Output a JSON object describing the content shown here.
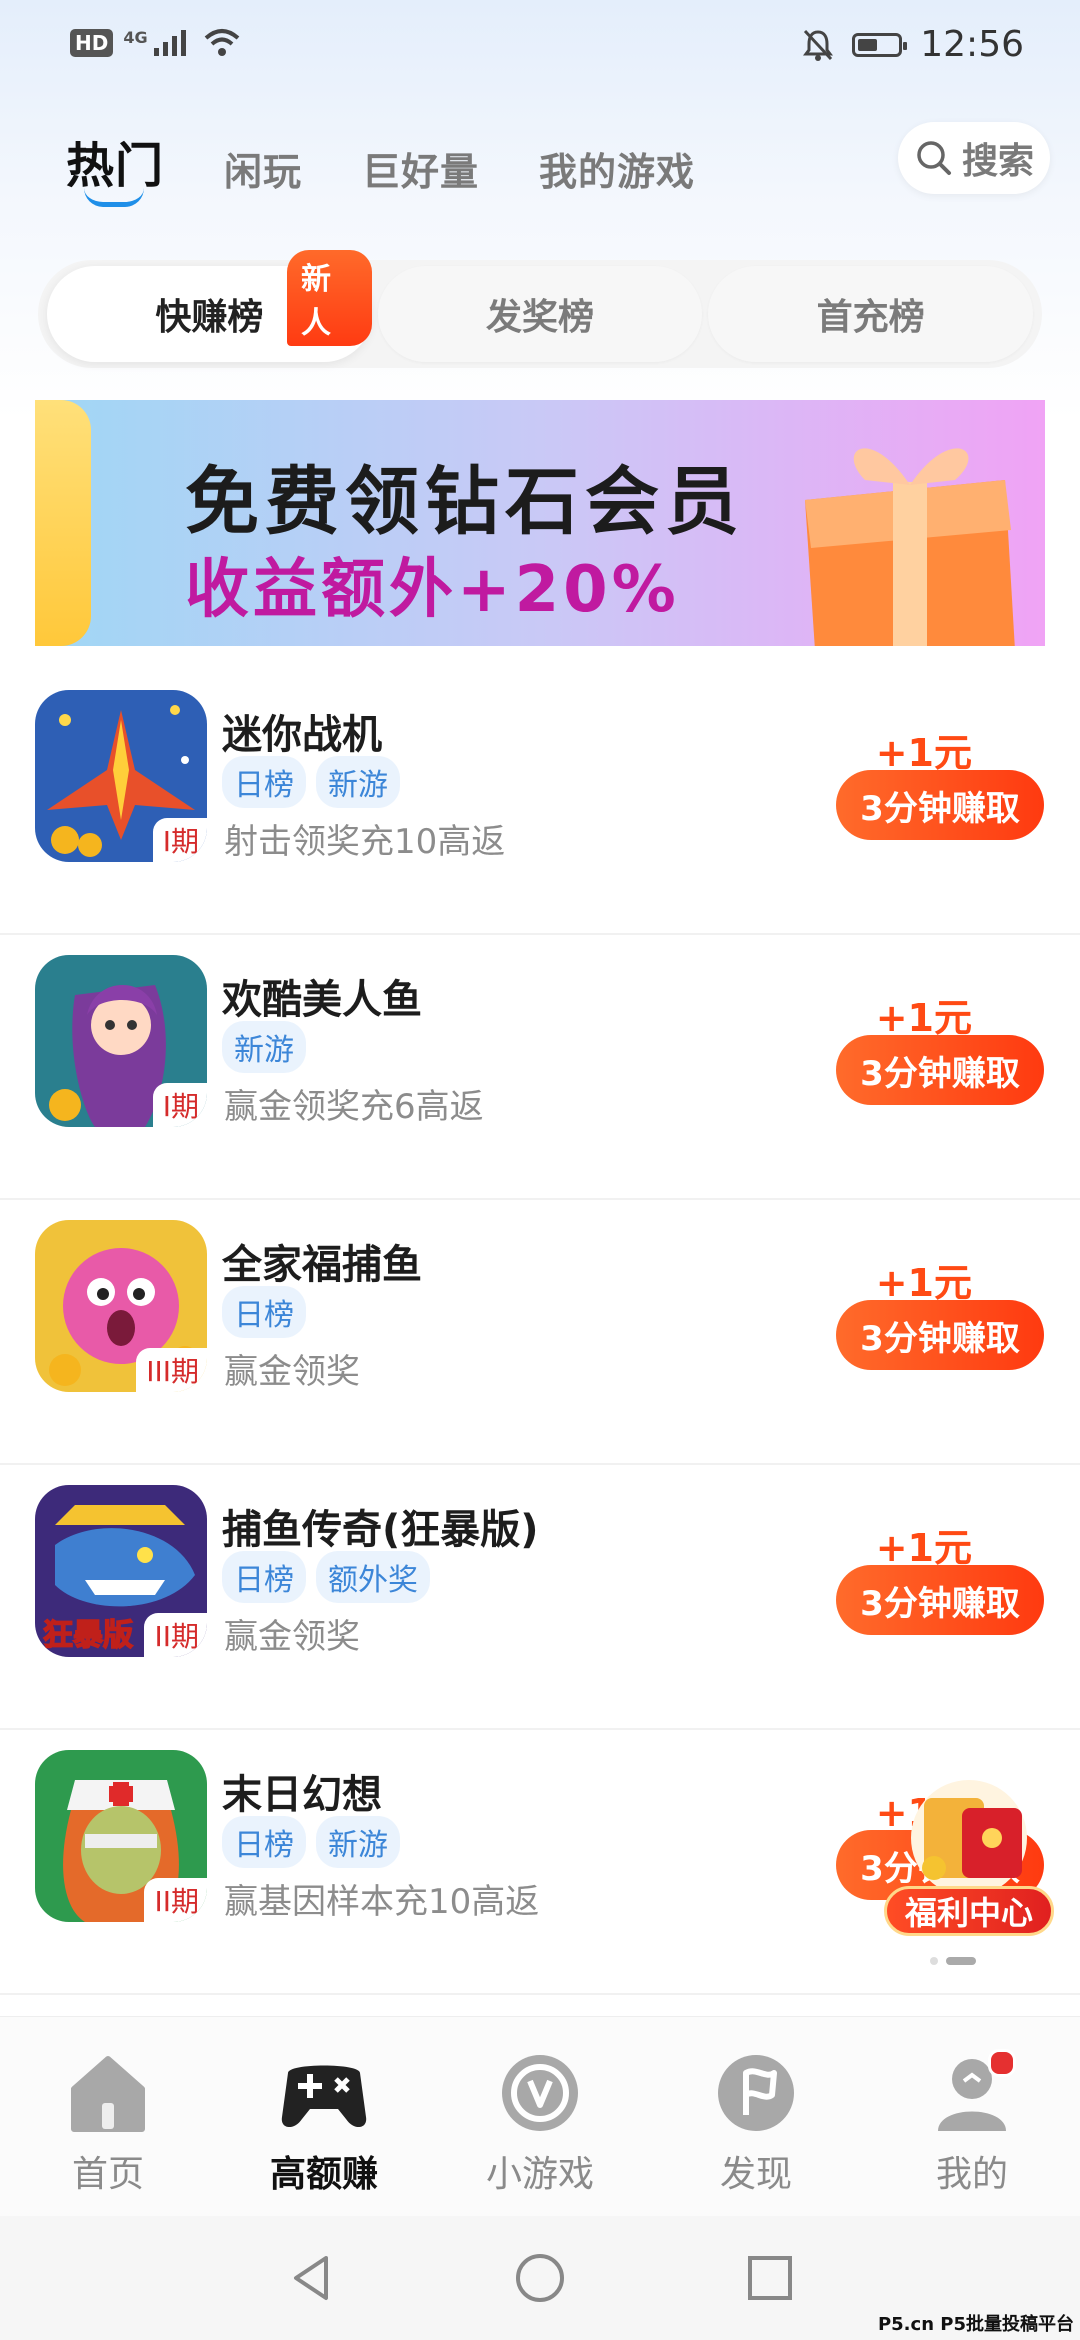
{
  "status_bar": {
    "hd": "HD",
    "network": "4G",
    "time": "12:56",
    "battery_level": 0.5
  },
  "top_tabs": [
    {
      "label": "热门",
      "active": true
    },
    {
      "label": "闲玩"
    },
    {
      "label": "巨好量"
    },
    {
      "label": "我的游戏"
    }
  ],
  "search": {
    "label": "搜索"
  },
  "rank_tabs": [
    {
      "label": "快赚榜",
      "badge": "新人",
      "active": true
    },
    {
      "label": "发奖榜"
    },
    {
      "label": "首充榜"
    }
  ],
  "banner": {
    "title": "免费领钻石会员",
    "subtitle": "收益额外+20%"
  },
  "games": [
    {
      "name": "迷你战机",
      "tags": [
        "日榜",
        "新游"
      ],
      "desc": "射击领奖充10高返",
      "period": "I期",
      "reward": "+1元",
      "button": "3分钟赚取",
      "icon": "jet-fighter-icon"
    },
    {
      "name": "欢酷美人鱼",
      "tags": [
        "新游"
      ],
      "desc": "赢金领奖充6高返",
      "period": "I期",
      "reward": "+1元",
      "button": "3分钟赚取",
      "icon": "mermaid-icon"
    },
    {
      "name": "全家福捕鱼",
      "tags": [
        "日榜"
      ],
      "desc": "赢金领奖",
      "period": "III期",
      "reward": "+1元",
      "button": "3分钟赚取",
      "icon": "pufferfish-icon"
    },
    {
      "name": "捕鱼传奇(狂暴版)",
      "tags": [
        "日榜",
        "额外奖"
      ],
      "desc": "赢金领奖",
      "period": "II期",
      "reward": "+1元",
      "button": "3分钟赚取",
      "icon": "shark-icon",
      "icon_caption": "狂暴版"
    },
    {
      "name": "末日幻想",
      "tags": [
        "日榜",
        "新游"
      ],
      "desc": "赢基因样本充10高返",
      "period": "II期",
      "reward": "+1元",
      "button": "3分钟赚取",
      "icon": "nurse-zombie-icon"
    }
  ],
  "welfare": {
    "label": "福利中心"
  },
  "bottom_nav": [
    {
      "label": "首页",
      "icon": "home-icon"
    },
    {
      "label": "高额赚",
      "icon": "gamepad-icon",
      "active": true
    },
    {
      "label": "小游戏",
      "icon": "mini-game-icon"
    },
    {
      "label": "发现",
      "icon": "discover-flag-icon"
    },
    {
      "label": "我的",
      "icon": "profile-icon",
      "has_dot": true
    }
  ],
  "watermark": "P5.cn P5批量投稿平台",
  "colors": {
    "accent": "#ff4a14",
    "tab_blue": "#1f8fe8",
    "tag_blue": "#3c86d8",
    "period_red": "#d52b2b"
  }
}
